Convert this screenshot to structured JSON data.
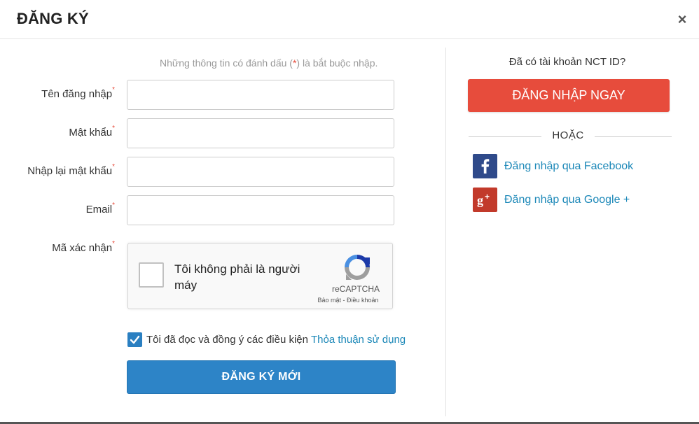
{
  "header": {
    "title": "ĐĂNG KÝ",
    "close_glyph": "×"
  },
  "note": {
    "before": "Những thông tin có đánh dấu (",
    "required_mark": "*",
    "after": ") là bắt buộc nhập."
  },
  "form": {
    "required_marker": "*",
    "fields": [
      {
        "label": "Tên đăng nhập",
        "value": "",
        "placeholder": ""
      },
      {
        "label": "Mật khẩu",
        "value": "",
        "placeholder": ""
      },
      {
        "label": "Nhập lại mật khẩu",
        "value": "",
        "placeholder": ""
      },
      {
        "label": "Email",
        "value": "",
        "placeholder": ""
      }
    ],
    "captcha_label": "Mã xác nhận",
    "captcha": {
      "checkbox_text": "Tôi không phải là người máy",
      "brand": "reCAPTCHA",
      "links": "Bảo mật - Điều khoản",
      "checked": false,
      "logo_icon": "recaptcha-logo-icon"
    },
    "agreement": {
      "checked": true,
      "text": "Tôi đã đọc và đồng ý các điều kiện",
      "link": "Thỏa thuận sử dụng"
    },
    "submit_label": "ĐĂNG KÝ MỚI"
  },
  "side": {
    "prompt": "Đã có tài khoản NCT ID?",
    "login_label": "ĐĂNG NHẬP NGAY",
    "or_label": "HOẶC",
    "social": [
      {
        "label": "Đăng nhập qua Facebook",
        "icon": "facebook-icon",
        "color": "#2f4a8a"
      },
      {
        "label": "Đăng nhập qua Google +",
        "icon": "google-plus-icon",
        "color": "#c23a2b"
      }
    ]
  },
  "colors": {
    "primary": "#2d84c7",
    "danger": "#e74c3c",
    "link": "#1c88b8"
  }
}
